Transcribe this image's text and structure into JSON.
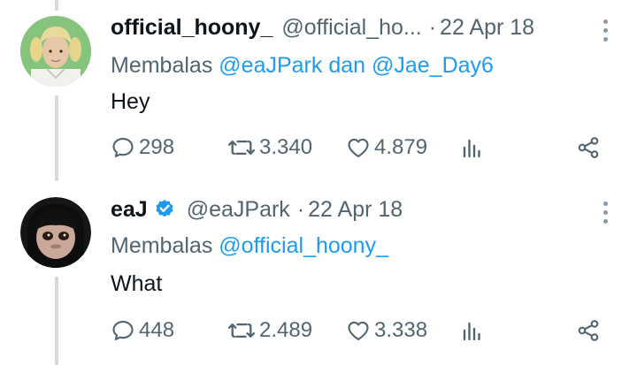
{
  "colors": {
    "text": "#0f1419",
    "muted": "#536471",
    "accent": "#1d9bf0",
    "thread_line": "#cfd9de"
  },
  "tweets": [
    {
      "author": {
        "name": "official_hoony_",
        "handle": "@official_ho...",
        "verified": false
      },
      "separator": "·",
      "date": "22 Apr 18",
      "reply_prefix": "Membalas",
      "mentions": [
        "@eaJPark",
        "@Jae_Day6"
      ],
      "mention_joiner": "dan",
      "text": "Hey",
      "stats": {
        "replies": "298",
        "retweets": "3.340",
        "likes": "4.879"
      },
      "icons": [
        "reply-icon",
        "retweet-icon",
        "like-icon",
        "views-icon",
        "share-icon",
        "more-icon"
      ]
    },
    {
      "author": {
        "name": "eaJ",
        "handle": "@eaJPark",
        "verified": true
      },
      "separator": "·",
      "date": "22 Apr 18",
      "reply_prefix": "Membalas",
      "mentions": [
        "@official_hoony_"
      ],
      "text": "What",
      "stats": {
        "replies": "448",
        "retweets": "2.489",
        "likes": "3.338"
      },
      "icons": [
        "reply-icon",
        "retweet-icon",
        "like-icon",
        "views-icon",
        "share-icon",
        "more-icon"
      ]
    }
  ]
}
